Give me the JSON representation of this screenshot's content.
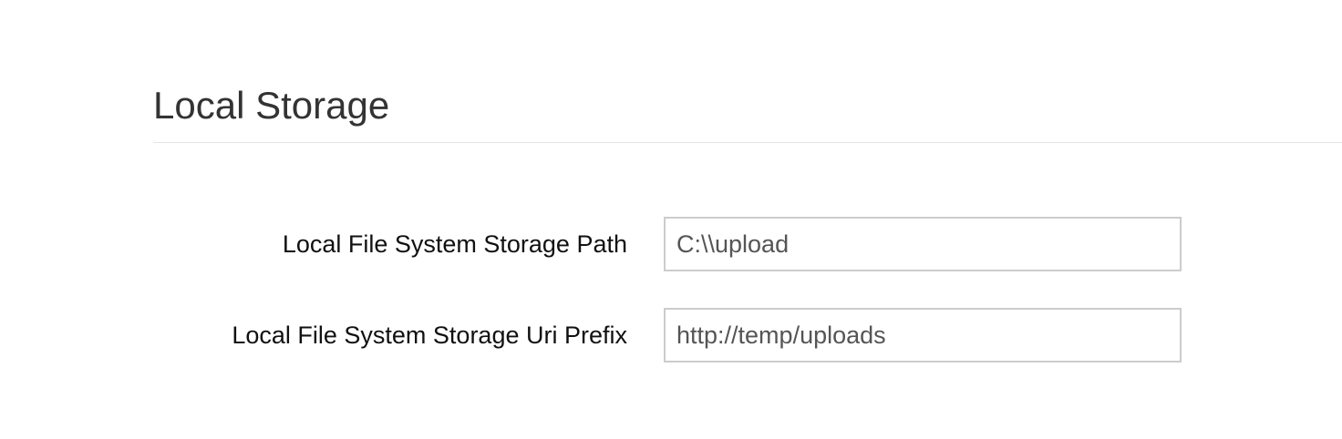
{
  "section": {
    "title": "Local Storage"
  },
  "form": {
    "fields": [
      {
        "label": "Local File System Storage Path",
        "value": "C:\\\\upload"
      },
      {
        "label": "Local File System Storage Uri Prefix",
        "value": "http://temp/uploads"
      }
    ]
  }
}
